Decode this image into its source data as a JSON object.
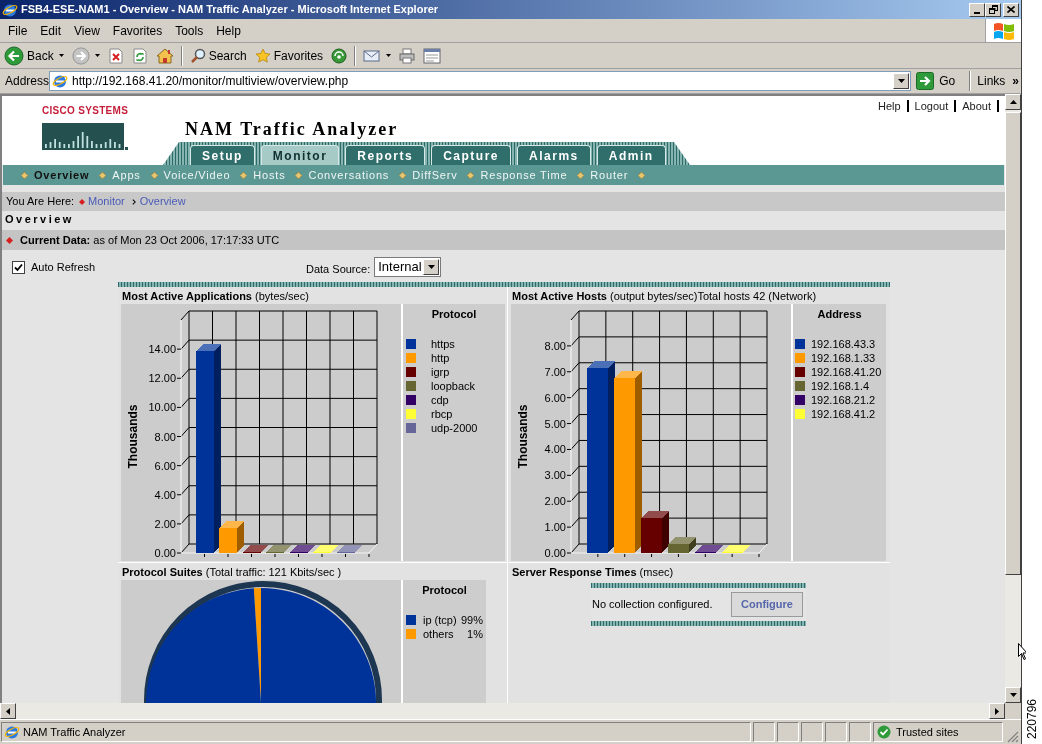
{
  "window": {
    "title": "FSB4-ESE-NAM1 - Overview - NAM Traffic Analyzer - Microsoft Internet Explorer"
  },
  "menu_bar": [
    "File",
    "Edit",
    "View",
    "Favorites",
    "Tools",
    "Help"
  ],
  "toolbar": [
    [
      {
        "kind": "back",
        "label": "Back",
        "dropdown": true
      },
      {
        "kind": "forward",
        "dropdown": true
      },
      {
        "kind": "stop",
        "dropdown": false
      },
      {
        "kind": "refresh",
        "dropdown": false
      },
      {
        "kind": "home",
        "dropdown": false
      }
    ],
    [
      {
        "kind": "search",
        "label": "Search",
        "dropdown": false
      },
      {
        "kind": "favorites",
        "label": "Favorites",
        "dropdown": false
      },
      {
        "kind": "media",
        "dropdown": false
      }
    ],
    [
      {
        "kind": "mail",
        "dropdown": true
      },
      {
        "kind": "print",
        "dropdown": false
      },
      {
        "kind": "edit",
        "dropdown": false
      }
    ]
  ],
  "address_bar": {
    "label": "Address",
    "url": "http://192.168.41.20/monitor/multiview/overview.php",
    "go": "Go",
    "links": "Links",
    "more": "»"
  },
  "page": {
    "brand": "CISCO SYSTEMS",
    "app_title": "NAM Traffic Analyzer",
    "top_links": [
      "Help",
      "Logout",
      "About"
    ],
    "tabs": [
      {
        "label": "Setup",
        "selected": false
      },
      {
        "label": "Monitor",
        "selected": true
      },
      {
        "label": "Reports",
        "selected": false
      },
      {
        "label": "Capture",
        "selected": false
      },
      {
        "label": "Alarms",
        "selected": false
      },
      {
        "label": "Admin",
        "selected": false
      }
    ],
    "subnav": [
      {
        "label": "Overview",
        "selected": true
      },
      {
        "label": "Apps",
        "selected": false
      },
      {
        "label": "Voice/Video",
        "selected": false
      },
      {
        "label": "Hosts",
        "selected": false
      },
      {
        "label": "Conversations",
        "selected": false
      },
      {
        "label": "DiffServ",
        "selected": false
      },
      {
        "label": "Response Time",
        "selected": false
      },
      {
        "label": "Router",
        "selected": false
      }
    ],
    "breadcrumb": {
      "label": "You Are Here:",
      "items": [
        {
          "kind": "section",
          "label": "Monitor"
        },
        {
          "kind": "page",
          "label": "Overview"
        }
      ]
    },
    "heading": "Overview",
    "current_data": "**Current Data:** as of Mon 23 Oct 2006, 17:17:33 UTC",
    "auto_refresh": {
      "label": "Auto Refresh",
      "checked": true
    },
    "data_source": {
      "label": "Data Source:",
      "value": "Internal"
    },
    "panels": [
      {
        "kind": "chart",
        "title": "**Most Active Applications** (bytes/sec)",
        "chart_data": {
          "type": "bar",
          "ylabel": "Thousands",
          "legend": {
            "title": "Protocol"
          },
          "series": [
            {
              "name": "https",
              "color": "#003399",
              "values": [
                13.9
              ]
            },
            {
              "name": "http",
              "color": "#ff9900",
              "values": [
                1.75
              ]
            },
            {
              "name": "igrp",
              "color": "#660000",
              "values": [
                0.05
              ]
            },
            {
              "name": "loopback",
              "color": "#666633",
              "values": [
                0.05
              ]
            },
            {
              "name": "cdp",
              "color": "#330066",
              "values": [
                0.05
              ]
            },
            {
              "name": "rbcp",
              "color": "#ffff33",
              "values": [
                0.05
              ]
            },
            {
              "name": "udp-2000",
              "color": "#666699",
              "values": [
                0.05
              ]
            }
          ],
          "ylim": [
            0,
            16
          ],
          "yticks": [
            {
              "value": 0,
              "label": "0.00"
            },
            {
              "value": 2,
              "label": "2.00"
            },
            {
              "value": 4,
              "label": "4.00"
            },
            {
              "value": 6,
              "label": "6.00"
            },
            {
              "value": 8,
              "label": "8.00"
            },
            {
              "value": 10,
              "label": "10.00"
            },
            {
              "value": 12,
              "label": "12.00"
            },
            {
              "value": 14,
              "label": "14.00"
            }
          ]
        }
      },
      {
        "kind": "chart",
        "title": "**Most Active Hosts** (output bytes/sec)Total hosts 42 (Network)",
        "chart_data": {
          "type": "bar",
          "ylabel": "Thousands",
          "legend": {
            "title": "Address"
          },
          "series": [
            {
              "name": "192.168.43.3",
              "color": "#003399",
              "values": [
                7.15
              ]
            },
            {
              "name": "192.168.1.33",
              "color": "#ff9900",
              "values": [
                6.77
              ]
            },
            {
              "name": "192.168.41.20",
              "color": "#660000",
              "values": [
                1.36
              ]
            },
            {
              "name": "192.168.1.4",
              "color": "#666633",
              "values": [
                0.35
              ]
            },
            {
              "name": "192.168.21.2",
              "color": "#330066",
              "values": [
                0.05
              ]
            },
            {
              "name": "192.168.41.2",
              "color": "#ffff33",
              "values": [
                0.05
              ]
            }
          ],
          "ylim": [
            0,
            9
          ],
          "yticks": [
            {
              "value": 0,
              "label": "0.00"
            },
            {
              "value": 1,
              "label": "1.00"
            },
            {
              "value": 2,
              "label": "2.00"
            },
            {
              "value": 3,
              "label": "3.00"
            },
            {
              "value": 4,
              "label": "4.00"
            },
            {
              "value": 5,
              "label": "5.00"
            },
            {
              "value": 6,
              "label": "6.00"
            },
            {
              "value": 7,
              "label": "7.00"
            },
            {
              "value": 8,
              "label": "8.00"
            }
          ]
        }
      },
      {
        "kind": "chart",
        "title": "**Protocol Suites** (Total traffic: 121 Kbits/sec )",
        "chart_data": {
          "type": "pie",
          "legend": {
            "title": "Protocol"
          },
          "series": [
            {
              "name": "others",
              "color": "#ff9900",
              "values": [
                1
              ]
            },
            {
              "name": "ip (tcp)",
              "color": "#003399",
              "values": [
                99
              ]
            }
          ],
          "value_labels": [
            "1%",
            "99%"
          ]
        }
      },
      {
        "kind": "message",
        "title": "**Server Response Times** (msec)",
        "message": "No collection configured.",
        "button": "Configure"
      }
    ]
  },
  "status_bar": {
    "text": "NAM Traffic Analyzer",
    "zone": "Trusted sites"
  },
  "figure_number": "220796"
}
